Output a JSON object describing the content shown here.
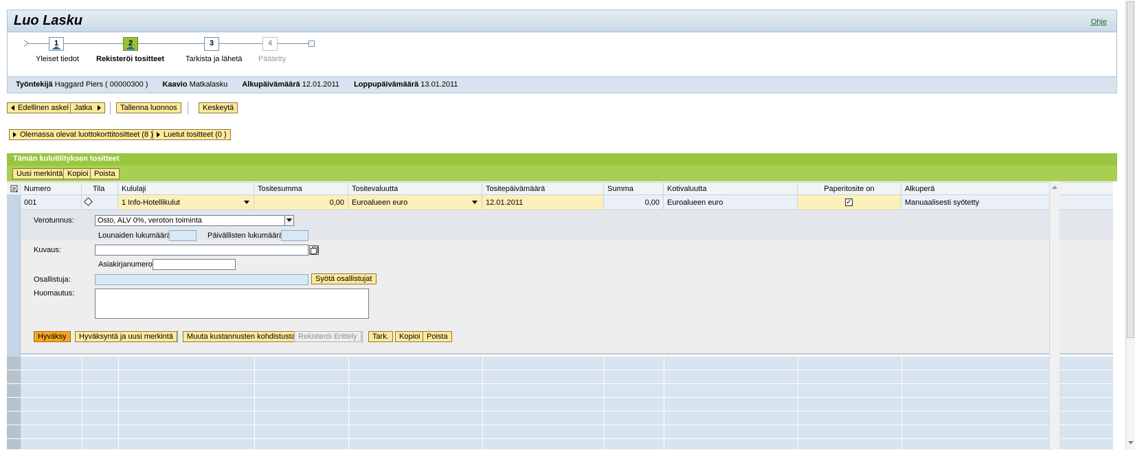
{
  "page": {
    "title": "Luo Lasku",
    "help": "Ohje"
  },
  "roadmap": {
    "steps": [
      {
        "num": "1",
        "label": "Yleiset tiedot"
      },
      {
        "num": "2",
        "label": "Rekisteröi tositteet"
      },
      {
        "num": "3",
        "label": "Tarkista ja lähetä"
      },
      {
        "num": "4",
        "label": "Päätetty"
      }
    ]
  },
  "context": {
    "employee_label": "Työntekijä",
    "employee_value": "Haggard Piers ( 00000300 )",
    "schema_label": "Kaavio",
    "schema_value": "Matkalasku",
    "start_label": "Alkupäivämäärä",
    "start_value": "12.01.2011",
    "end_label": "Loppupäivämäärä",
    "end_value": "13.01.2011"
  },
  "nav": {
    "prev": "Edellinen askel",
    "next": "Jatka",
    "save_draft": "Tallenna luonnos",
    "cancel": "Keskeytä"
  },
  "expanders": {
    "credit_card": "Olemassa olevat luottokorttitositteet (8 )",
    "read_receipts": "Luetut tositteet (0 )"
  },
  "section": {
    "title": "Tämän kulutilityksen tositteet"
  },
  "table_toolbar": {
    "new_entry": "Uusi merkintä",
    "copy": "Kopioi",
    "delete": "Poista"
  },
  "table": {
    "columns": [
      "Numero",
      "Tila",
      "Kululaji",
      "Tositesumma",
      "Tositevaluutta",
      "Tositepäivämäärä",
      "Summa",
      "Kotivaluutta",
      "Paperitosite on",
      "Alkuperä"
    ],
    "row": {
      "number": "001",
      "expense_type": "1 Info-Hotellikulut",
      "receipt_amount": "0,00",
      "receipt_currency": "Euroalueen euro",
      "receipt_date": "12.01.2011",
      "amount": "0,00",
      "home_currency": "Euroalueen euro",
      "paper_receipt": "✓",
      "origin": "Manuaalisesti syötetty"
    }
  },
  "detail": {
    "tax_code_label": "Verotunnus:",
    "tax_code_value": "Osto, ALV 0%, veroton toiminta",
    "lunches_label": "Lounaiden lukumäärä:",
    "dinners_label": "Päivällisten lukumäärä:",
    "description_label": "Kuvaus:",
    "document_number_label": "Asiakirjanumero:",
    "participants_label": "Osallistuja:",
    "enter_participants": "Syötä osallistujat",
    "note_label": "Huomautus:"
  },
  "detail_actions": {
    "accept": "Hyväksy",
    "accept_new": "Hyväksyntä ja uusi merkintä",
    "change_costs": "Muuta kustannusten kohdistusta",
    "register_breakdown": "Rekisteröi Erittely",
    "check": "Tark.",
    "copy": "Kopioi",
    "delete": "Poista"
  }
}
